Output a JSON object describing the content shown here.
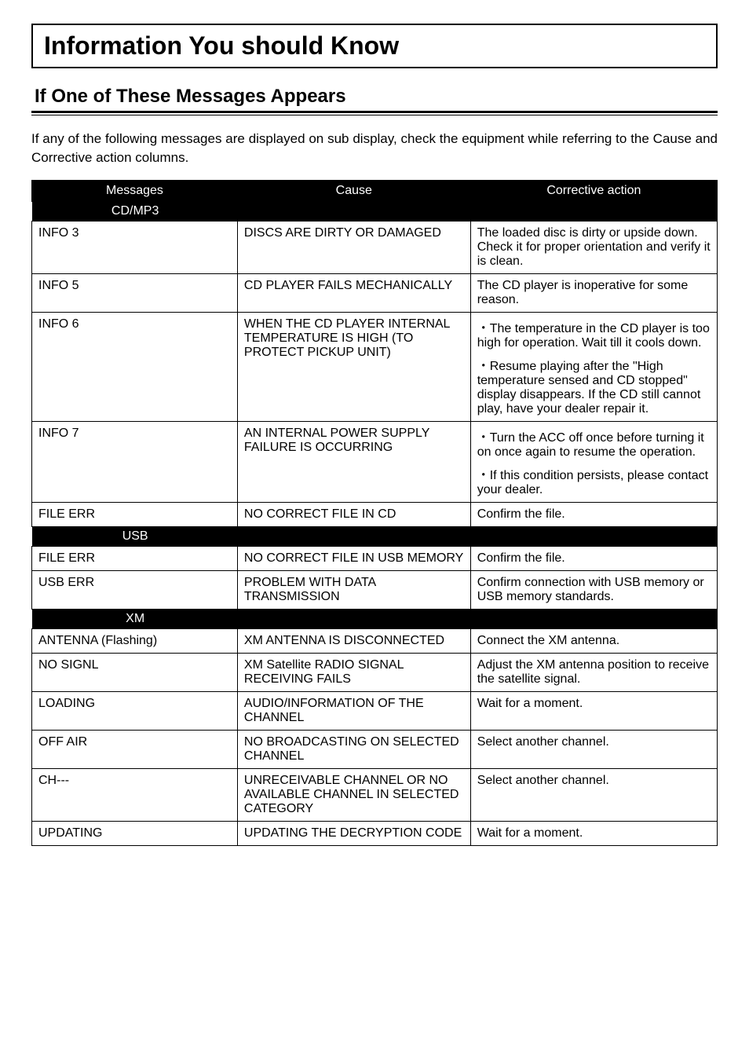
{
  "mainTitle": "Information You should Know",
  "subHeading": "If One of These Messages Appears",
  "intro": "If any of the following messages are displayed on sub display, check the equipment while referring to the Cause and Corrective action columns.",
  "headers": {
    "messages": "Messages",
    "cause": "Cause",
    "action": "Corrective action"
  },
  "sections": [
    {
      "label": "CD/MP3",
      "rows": [
        {
          "msg": "INFO 3",
          "cause": "DISCS ARE DIRTY OR DAMAGED",
          "action": "The loaded disc is dirty or upside down. Check it for proper orientation and verify it is clean."
        },
        {
          "msg": "INFO 5",
          "cause": "CD PLAYER FAILS MECHANICALLY",
          "action": "The CD player is inoperative for some reason."
        },
        {
          "msg": "INFO 6",
          "cause": "WHEN THE CD PLAYER INTERNAL TEMPERATURE IS HIGH (TO PROTECT PICKUP UNIT)",
          "actionParas": [
            "・The temperature in the CD player is too high for operation. Wait till it cools down.",
            "・Resume playing after the \"High temperature sensed and CD stopped\" display disappears. If the CD still cannot play, have your dealer repair it."
          ]
        },
        {
          "msg": "INFO 7",
          "cause": "AN INTERNAL POWER SUPPLY FAILURE IS OCCURRING",
          "actionParas": [
            "・Turn the ACC off once before turning it on once again to resume the operation.",
            "・If this condition persists, please contact your dealer."
          ]
        },
        {
          "msg": "FILE ERR",
          "cause": "NO CORRECT FILE IN CD",
          "action": "Confirm the file."
        }
      ]
    },
    {
      "label": "USB",
      "rows": [
        {
          "msg": "FILE ERR",
          "cause": "NO CORRECT FILE IN USB MEMORY",
          "action": "Confirm the file."
        },
        {
          "msg": "USB ERR",
          "cause": "PROBLEM WITH DATA TRANSMISSION",
          "action": "Confirm connection with USB memory or USB memory standards."
        }
      ]
    },
    {
      "label": "XM",
      "rows": [
        {
          "msg": "ANTENNA (Flashing)",
          "cause": "XM ANTENNA IS DISCONNECTED",
          "action": "Connect the XM antenna."
        },
        {
          "msg": "NO SIGNL",
          "cause": "XM Satellite RADIO SIGNAL RECEIVING FAILS",
          "action": "Adjust the XM antenna position to receive the satellite signal."
        },
        {
          "msg": "LOADING",
          "cause": "AUDIO/INFORMATION OF THE CHANNEL",
          "action": "Wait for a moment."
        },
        {
          "msg": "OFF AIR",
          "cause": "NO BROADCASTING ON SELECTED CHANNEL",
          "action": "Select another channel."
        },
        {
          "msg": "CH---",
          "cause": "UNRECEIVABLE CHANNEL OR NO AVAILABLE CHANNEL IN SELECTED CATEGORY",
          "action": "Select another channel."
        },
        {
          "msg": "UPDATING",
          "cause": "UPDATING THE DECRYPTION CODE",
          "action": "Wait for a moment."
        }
      ]
    }
  ]
}
